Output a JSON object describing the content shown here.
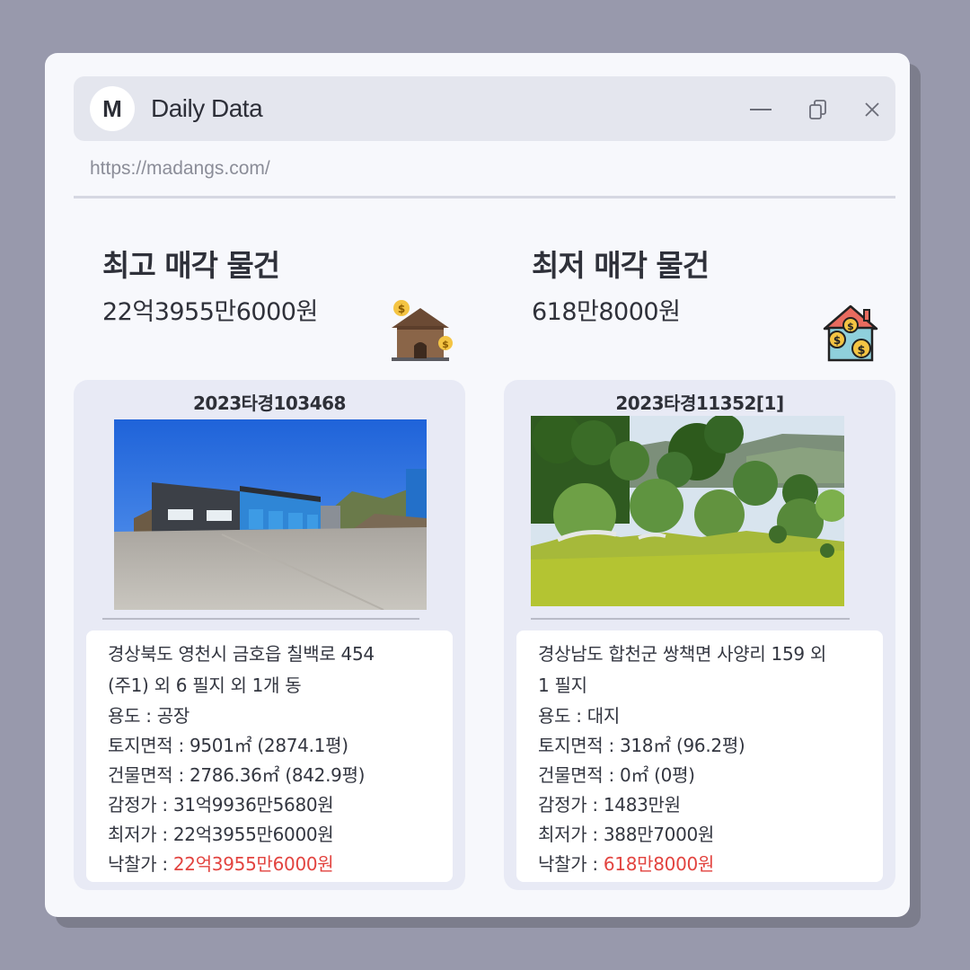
{
  "window": {
    "logo_letter": "M",
    "title": "Daily Data",
    "url": "https://madangs.com/"
  },
  "highest": {
    "title": "최고 매각 물건",
    "price": "22억3955만6000원",
    "icon": "house-money-icon",
    "case_number": "2023타경103468",
    "address_line1": "경상북도 영천시 금호읍 칠백로 454",
    "address_line2": "(주1) 외 6 필지 외 1개 동",
    "usage": "용도 : 공장",
    "land_area": "토지면적 : 9501㎡ (2874.1평)",
    "building_area": "건물면적 : 2786.36㎡ (842.9평)",
    "appraisal": "감정가 : 31억9936만5680원",
    "minimum": "최저가 : 22억3955만6000원",
    "winning_label": "낙찰가 : ",
    "winning_value": "22억3955만6000원"
  },
  "lowest": {
    "title": "최저 매각 물건",
    "price": "618만8000원",
    "icon": "house-coins-icon",
    "case_number": "2023타경11352[1]",
    "address_line1": "경상남도 합천군 쌍책면 사양리 159 외",
    "address_line2": "1 필지",
    "usage": "용도 : 대지",
    "land_area": "토지면적 : 318㎡ (96.2평)",
    "building_area": "건물면적 : 0㎡ (0평)",
    "appraisal": "감정가 : 1483만원",
    "minimum": "최저가 : 388만7000원",
    "winning_label": "낙찰가 : ",
    "winning_value": "618만8000원"
  },
  "colors": {
    "background": "#9899ac",
    "window": "#f7f8fc",
    "card": "#e8eaf5",
    "accent_red": "#e2433f"
  }
}
